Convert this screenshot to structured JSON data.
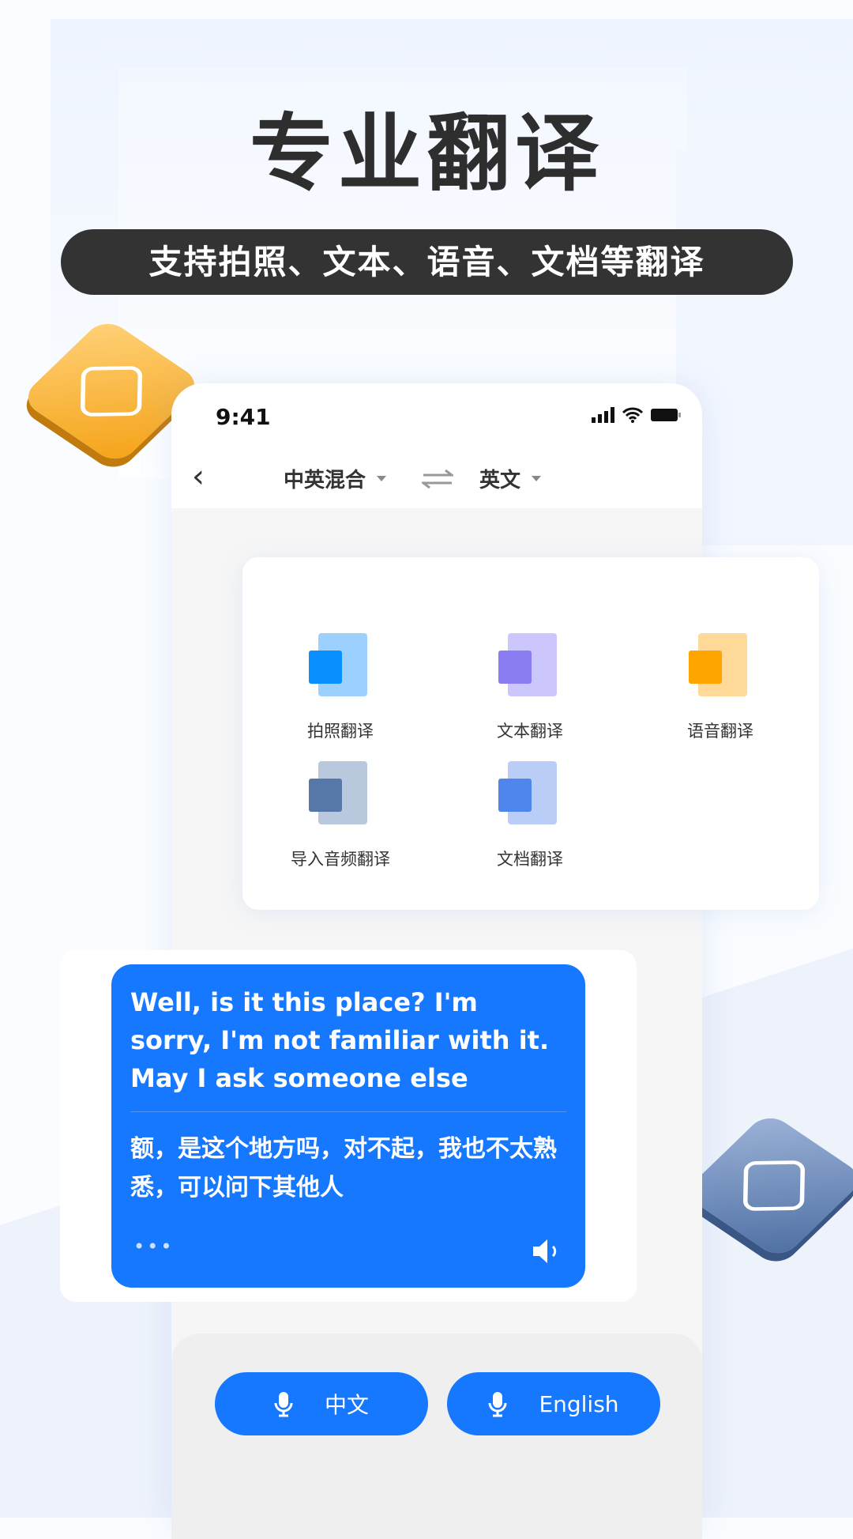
{
  "header": {
    "title": "专业翻译",
    "subtitle": "支持拍照、文本、语音、文档等翻译"
  },
  "status_bar": {
    "time": "9:41"
  },
  "nav": {
    "source_lang": "中英混合",
    "target_lang": "英文"
  },
  "menu": {
    "items": [
      {
        "label": "拍照翻译",
        "icon": "camera-doc-icon",
        "color": "#0a8fff"
      },
      {
        "label": "文本翻译",
        "icon": "text-doc-icon",
        "color": "#8a7cf3"
      },
      {
        "label": "语音翻译",
        "icon": "mic-doc-icon",
        "color": "#ffa500"
      },
      {
        "label": "导入音频翻译",
        "icon": "audio-doc-icon",
        "color": "#5677a8"
      },
      {
        "label": "文档翻译",
        "icon": "word-doc-icon",
        "color": "#4f86ec"
      }
    ]
  },
  "chat": {
    "english": "Well, is it this place? I'm sorry, I'm not familiar with it. May I ask someone else",
    "chinese": "额，是这个地方吗，对不起，我也不太熟悉，可以问下其他人",
    "more": "•••"
  },
  "buttons": {
    "chinese": "中文",
    "english": "English"
  },
  "colors": {
    "accent": "#1677ff",
    "pill": "#333333"
  }
}
